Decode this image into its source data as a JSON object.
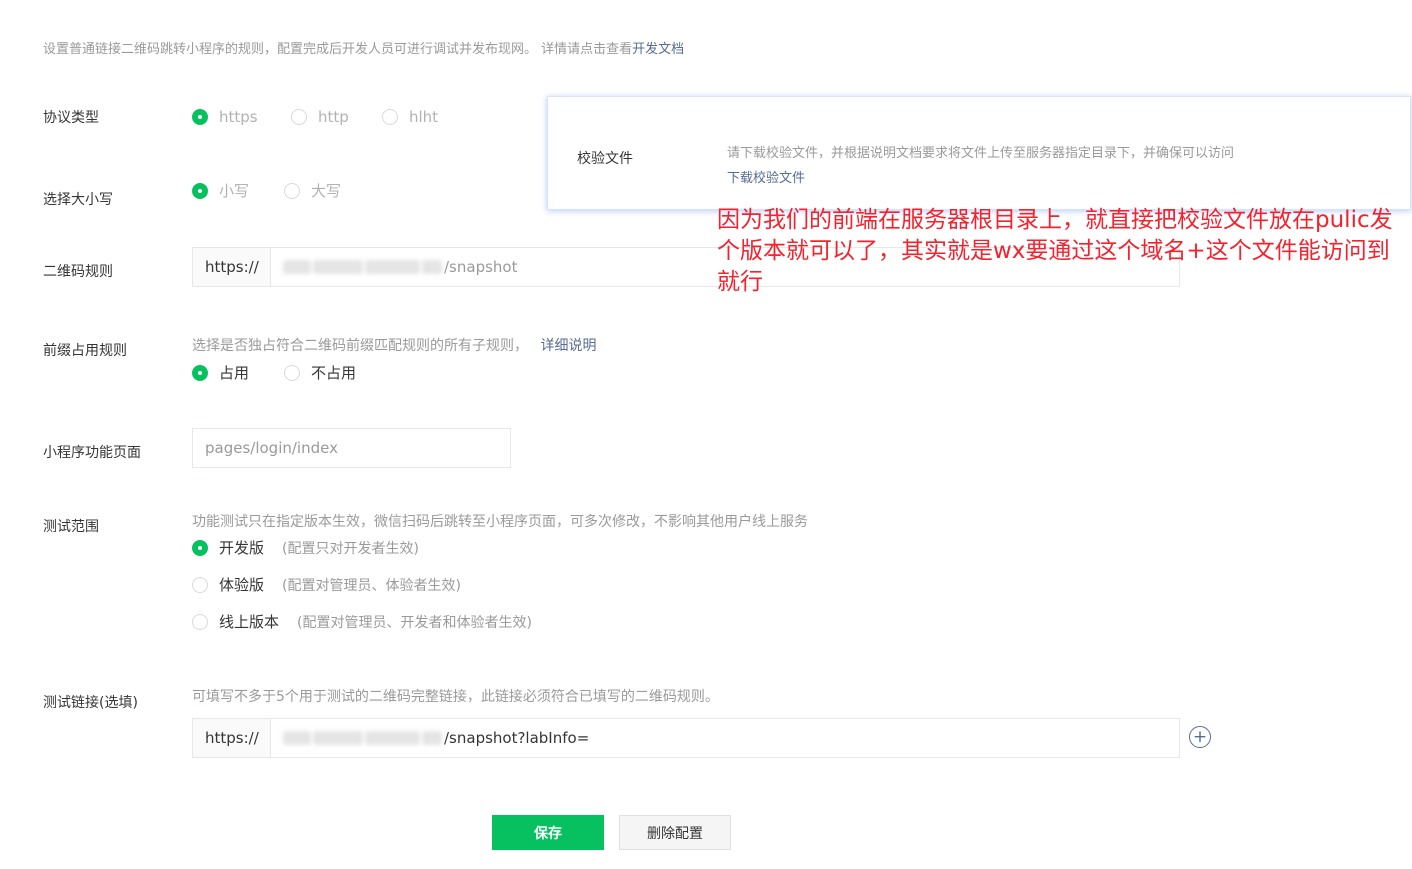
{
  "intro": {
    "text": "设置普通链接二维码跳转小程序的规则，配置完成后开发人员可进行调试并发布现网。 详情请点击查看",
    "link": "开发文档"
  },
  "protocol": {
    "label": "协议类型",
    "options": [
      "https",
      "http",
      "hlht"
    ],
    "selected": "https"
  },
  "case": {
    "label": "选择大小写",
    "options": [
      "小写",
      "大写"
    ],
    "selected": "小写"
  },
  "qr_rule": {
    "label": "二维码规则",
    "prefix": "https://",
    "value_suffix": "/snapshot"
  },
  "prefix_rule": {
    "label": "前缀占用规则",
    "hint": "选择是否独占符合二维码前缀匹配规则的所有子规则，",
    "hint_link": "详细说明",
    "options": [
      "占用",
      "不占用"
    ],
    "selected": "占用"
  },
  "mini_page": {
    "label": "小程序功能页面",
    "placeholder": "pages/login/index"
  },
  "test_scope": {
    "label": "测试范围",
    "hint": "功能测试只在指定版本生效，微信扫码后跳转至小程序页面，可多次修改，不影响其他用户线上服务",
    "options": [
      {
        "label": "开发版",
        "desc": "(配置只对开发者生效)"
      },
      {
        "label": "体验版",
        "desc": "(配置对管理员、体验者生效)"
      },
      {
        "label": "线上版本",
        "desc": "(配置对管理员、开发者和体验者生效)"
      }
    ],
    "selected": "开发版"
  },
  "test_link": {
    "label": "测试链接(选填)",
    "hint": "可填写不多于5个用于测试的二维码完整链接，此链接必须符合已填写的二维码规则。",
    "prefix": "https://",
    "value_suffix": "/snapshot?labInfo="
  },
  "popup": {
    "label": "校验文件",
    "text": "请下载校验文件，并根据说明文档要求将文件上传至服务器指定目录下，并确保可以访问",
    "link": "下载校验文件"
  },
  "annotation": "因为我们的前端在服务器根目录上，就直接把校验文件放在pulic发个版本就可以了，其实就是wx要通过这个域名+这个文件能访问到就行",
  "buttons": {
    "save": "保存",
    "delete": "删除配置",
    "add_icon": "+"
  },
  "colors": {
    "primary_green": "#07c160",
    "link_blue": "#576b95",
    "annotation_red": "#f5222d"
  }
}
